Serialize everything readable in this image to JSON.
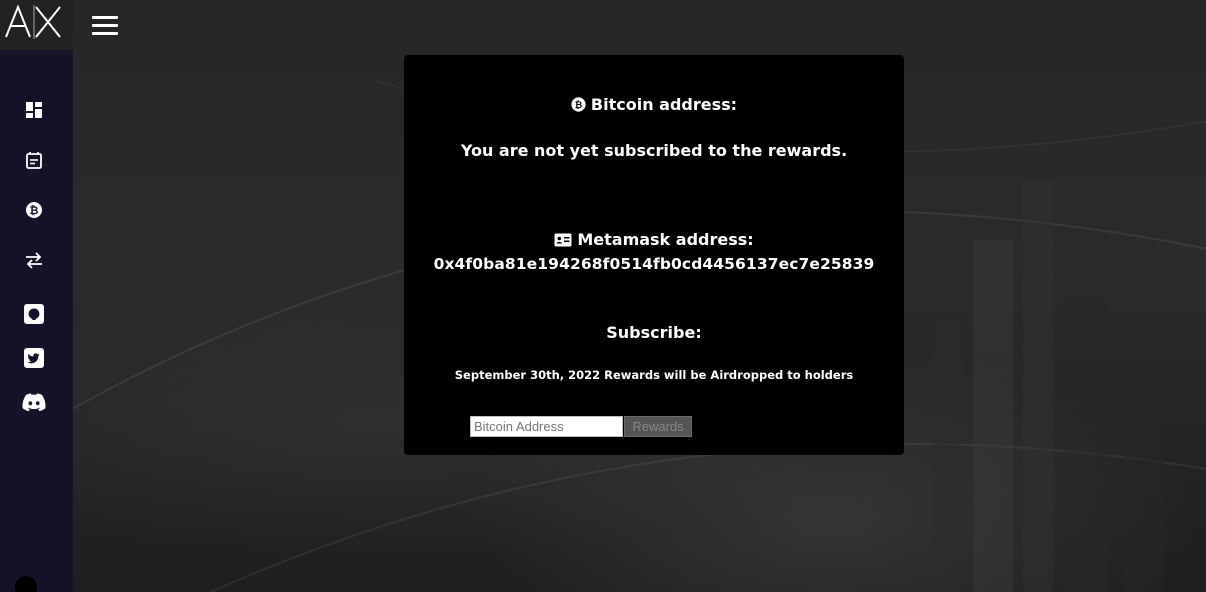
{
  "brand": {
    "logo_text": "AX"
  },
  "sidebar": {
    "items": [
      {
        "name": "dashboard-icon"
      },
      {
        "name": "calendar-icon"
      },
      {
        "name": "bitcoin-icon"
      },
      {
        "name": "transfer-icon"
      },
      {
        "name": "github-icon"
      },
      {
        "name": "twitter-icon"
      },
      {
        "name": "discord-icon"
      }
    ]
  },
  "card": {
    "bitcoin_label": "Bitcoin address:",
    "not_subscribed": "You are not yet subscribed to the rewards.",
    "metamask_label": "Metamask address:",
    "metamask_address": "0x4f0ba81e194268f0514fb0cd4456137ec7e25839",
    "subscribe_title": "Subscribe:",
    "airdrop_note": "September 30th, 2022 Rewards will be Airdropped to holders",
    "input_placeholder": "Bitcoin Address",
    "button_label": "Rewards"
  },
  "colors": {
    "sidebar": "#15132a",
    "card": "#000000",
    "background": "#232323"
  }
}
